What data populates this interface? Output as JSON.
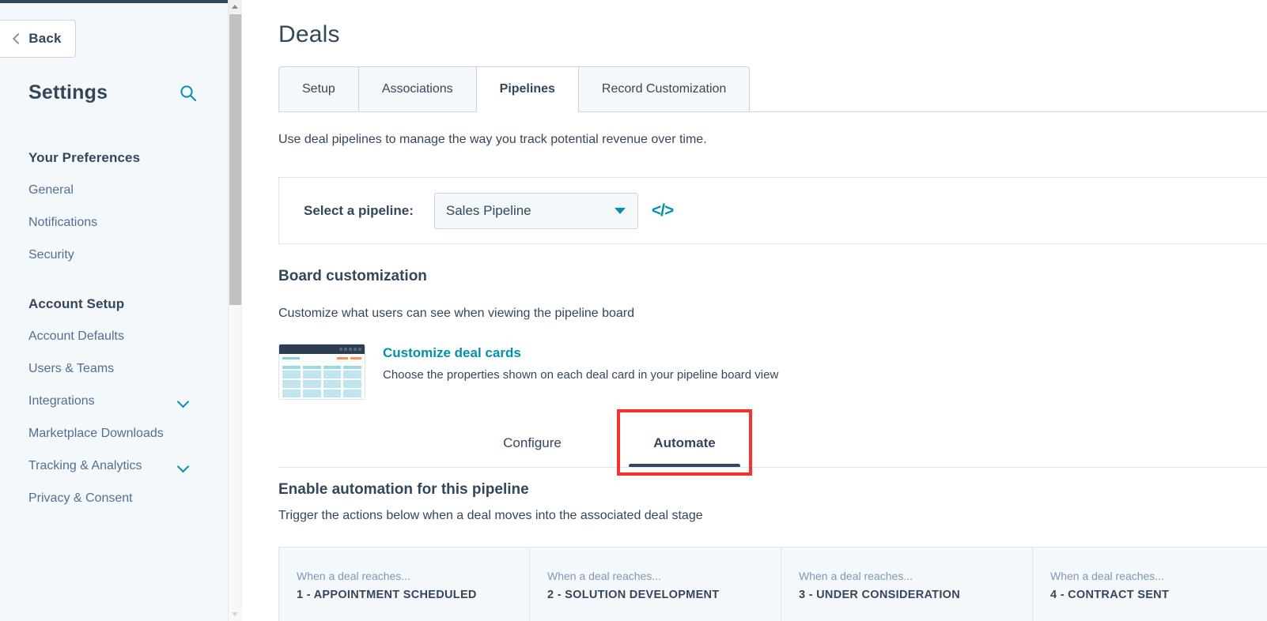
{
  "sidebar": {
    "back_label": "Back",
    "settings_title": "Settings",
    "search_icon": "search-icon",
    "groups": [
      {
        "title": "Your Preferences",
        "items": [
          {
            "label": "General",
            "expandable": false
          },
          {
            "label": "Notifications",
            "expandable": false
          },
          {
            "label": "Security",
            "expandable": false
          }
        ]
      },
      {
        "title": "Account Setup",
        "items": [
          {
            "label": "Account Defaults",
            "expandable": false
          },
          {
            "label": "Users & Teams",
            "expandable": false
          },
          {
            "label": "Integrations",
            "expandable": true
          },
          {
            "label": "Marketplace Downloads",
            "expandable": false
          },
          {
            "label": "Tracking & Analytics",
            "expandable": true
          },
          {
            "label": "Privacy & Consent",
            "expandable": false
          }
        ]
      }
    ]
  },
  "main": {
    "page_title": "Deals",
    "tabs": [
      {
        "label": "Setup",
        "active": false
      },
      {
        "label": "Associations",
        "active": false
      },
      {
        "label": "Pipelines",
        "active": true
      },
      {
        "label": "Record Customization",
        "active": false
      }
    ],
    "intro_text": "Use deal pipelines to manage the way you track potential revenue over time.",
    "pipeline_selector": {
      "label": "Select a pipeline:",
      "selected": "Sales Pipeline",
      "caret_icon": "chevron-down-icon",
      "code_icon": "</>"
    },
    "board_customization": {
      "title": "Board customization",
      "subtitle": "Customize what users can see when viewing the pipeline board",
      "link": "Customize deal cards",
      "description": "Choose the properties shown on each deal card in your pipeline board view"
    },
    "subtabs": [
      {
        "label": "Configure",
        "active": false
      },
      {
        "label": "Automate",
        "active": true,
        "highlighted": true
      }
    ],
    "automation": {
      "title": "Enable automation for this pipeline",
      "subtitle": "Trigger the actions below when a deal moves into the associated deal stage",
      "when_label": "When a deal reaches...",
      "stages": [
        "1 - APPOINTMENT SCHEDULED",
        "2 - SOLUTION DEVELOPMENT",
        "3 - UNDER CONSIDERATION",
        "4 - CONTRACT SENT"
      ]
    }
  },
  "colors": {
    "accent_teal": "#0091ae",
    "text_dark": "#33475b",
    "text_muted": "#516f90",
    "sidebar_bg": "#f5f8fa",
    "border": "#cbd6e2",
    "highlight_red": "#f8312f"
  }
}
